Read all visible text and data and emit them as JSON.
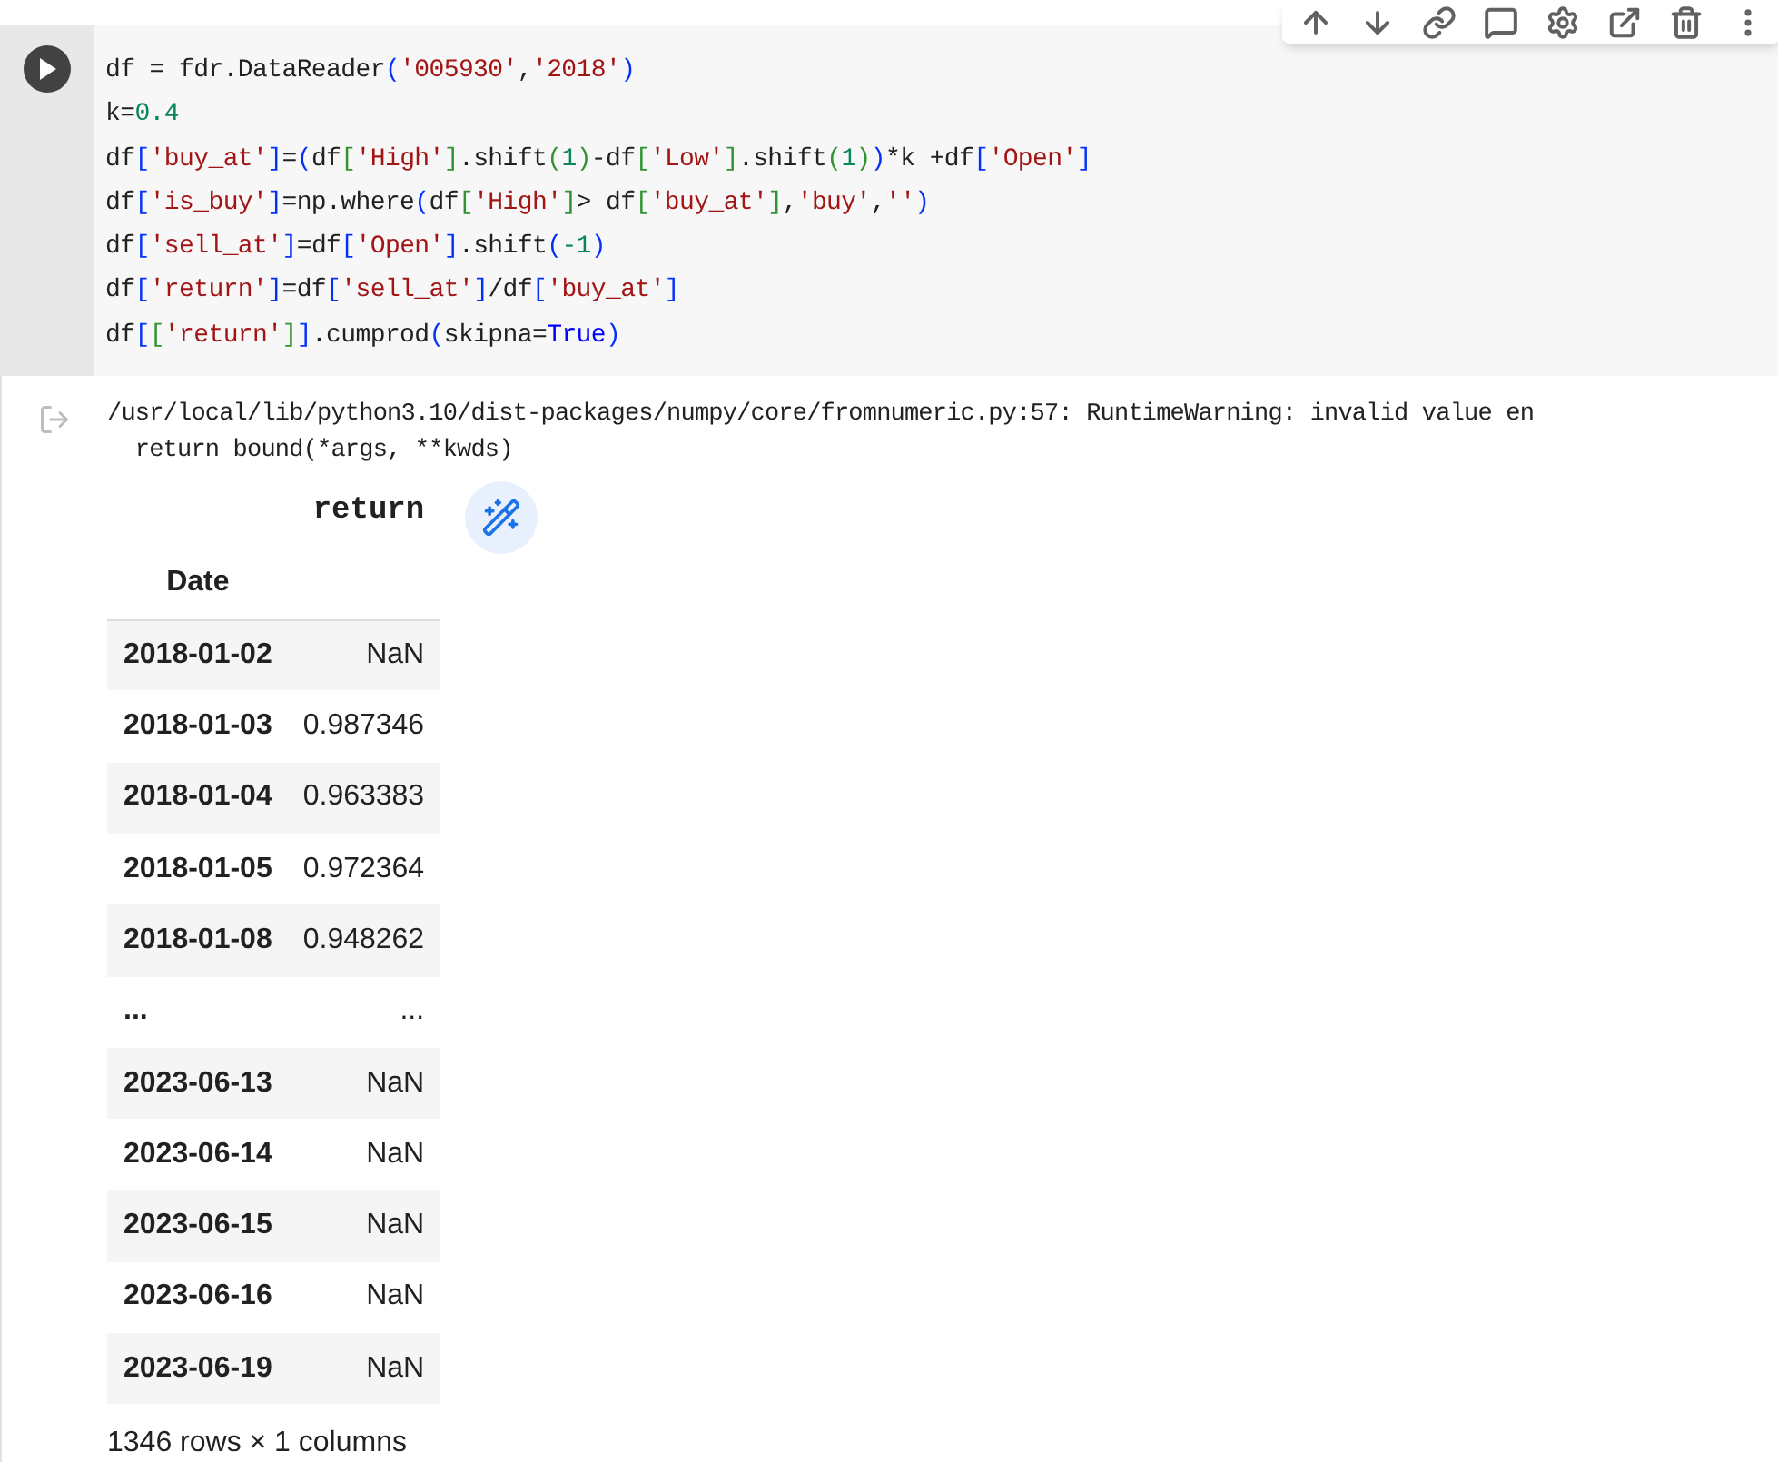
{
  "code_cell": {
    "lines": [
      [
        {
          "text": "df = fdr.DataReader",
          "kind": "plain"
        },
        {
          "text": "(",
          "kind": "b1"
        },
        {
          "text": "'005930'",
          "kind": "str"
        },
        {
          "text": ",",
          "kind": "plain"
        },
        {
          "text": "'2018'",
          "kind": "str"
        },
        {
          "text": ")",
          "kind": "b1"
        }
      ],
      [
        {
          "text": "k=",
          "kind": "plain"
        },
        {
          "text": "0.4",
          "kind": "num"
        }
      ],
      [
        {
          "text": "df",
          "kind": "plain"
        },
        {
          "text": "[",
          "kind": "b1"
        },
        {
          "text": "'buy_at'",
          "kind": "str"
        },
        {
          "text": "]",
          "kind": "b1"
        },
        {
          "text": "=",
          "kind": "plain"
        },
        {
          "text": "(",
          "kind": "b1"
        },
        {
          "text": "df",
          "kind": "plain"
        },
        {
          "text": "[",
          "kind": "b2"
        },
        {
          "text": "'High'",
          "kind": "str"
        },
        {
          "text": "]",
          "kind": "b2"
        },
        {
          "text": ".shift",
          "kind": "plain"
        },
        {
          "text": "(",
          "kind": "b2"
        },
        {
          "text": "1",
          "kind": "num"
        },
        {
          "text": ")",
          "kind": "b2"
        },
        {
          "text": "-df",
          "kind": "plain"
        },
        {
          "text": "[",
          "kind": "b2"
        },
        {
          "text": "'Low'",
          "kind": "str"
        },
        {
          "text": "]",
          "kind": "b2"
        },
        {
          "text": ".shift",
          "kind": "plain"
        },
        {
          "text": "(",
          "kind": "b2"
        },
        {
          "text": "1",
          "kind": "num"
        },
        {
          "text": ")",
          "kind": "b2"
        },
        {
          "text": ")",
          "kind": "b1"
        },
        {
          "text": "*k +df",
          "kind": "plain"
        },
        {
          "text": "[",
          "kind": "b1"
        },
        {
          "text": "'Open'",
          "kind": "str"
        },
        {
          "text": "]",
          "kind": "b1"
        }
      ],
      [
        {
          "text": "df",
          "kind": "plain"
        },
        {
          "text": "[",
          "kind": "b1"
        },
        {
          "text": "'is_buy'",
          "kind": "str"
        },
        {
          "text": "]",
          "kind": "b1"
        },
        {
          "text": "=np.where",
          "kind": "plain"
        },
        {
          "text": "(",
          "kind": "b1"
        },
        {
          "text": "df",
          "kind": "plain"
        },
        {
          "text": "[",
          "kind": "b2"
        },
        {
          "text": "'High'",
          "kind": "str"
        },
        {
          "text": "]",
          "kind": "b2"
        },
        {
          "text": "> df",
          "kind": "plain"
        },
        {
          "text": "[",
          "kind": "b2"
        },
        {
          "text": "'buy_at'",
          "kind": "str"
        },
        {
          "text": "]",
          "kind": "b2"
        },
        {
          "text": ",",
          "kind": "plain"
        },
        {
          "text": "'buy'",
          "kind": "str"
        },
        {
          "text": ",",
          "kind": "plain"
        },
        {
          "text": "''",
          "kind": "str"
        },
        {
          "text": ")",
          "kind": "b1"
        }
      ],
      [
        {
          "text": "df",
          "kind": "plain"
        },
        {
          "text": "[",
          "kind": "b1"
        },
        {
          "text": "'sell_at'",
          "kind": "str"
        },
        {
          "text": "]",
          "kind": "b1"
        },
        {
          "text": "=df",
          "kind": "plain"
        },
        {
          "text": "[",
          "kind": "b1"
        },
        {
          "text": "'Open'",
          "kind": "str"
        },
        {
          "text": "]",
          "kind": "b1"
        },
        {
          "text": ".shift",
          "kind": "plain"
        },
        {
          "text": "(",
          "kind": "b1"
        },
        {
          "text": "-1",
          "kind": "num"
        },
        {
          "text": ")",
          "kind": "b1"
        }
      ],
      [
        {
          "text": "df",
          "kind": "plain"
        },
        {
          "text": "[",
          "kind": "b1"
        },
        {
          "text": "'return'",
          "kind": "str"
        },
        {
          "text": "]",
          "kind": "b1"
        },
        {
          "text": "=df",
          "kind": "plain"
        },
        {
          "text": "[",
          "kind": "b1"
        },
        {
          "text": "'sell_at'",
          "kind": "str"
        },
        {
          "text": "]",
          "kind": "b1"
        },
        {
          "text": "/df",
          "kind": "plain"
        },
        {
          "text": "[",
          "kind": "b1"
        },
        {
          "text": "'buy_at'",
          "kind": "str"
        },
        {
          "text": "]",
          "kind": "b1"
        }
      ],
      [
        {
          "text": "df",
          "kind": "plain"
        },
        {
          "text": "[",
          "kind": "b1"
        },
        {
          "text": "[",
          "kind": "b2"
        },
        {
          "text": "'return'",
          "kind": "str"
        },
        {
          "text": "]",
          "kind": "b2"
        },
        {
          "text": "]",
          "kind": "b1"
        },
        {
          "text": ".cumprod",
          "kind": "plain"
        },
        {
          "text": "(",
          "kind": "b1"
        },
        {
          "text": "skipna=",
          "kind": "plain"
        },
        {
          "text": "True",
          "kind": "kw"
        },
        {
          "text": ")",
          "kind": "b1"
        }
      ]
    ]
  },
  "output": {
    "warning": [
      "/usr/local/lib/python3.10/dist-packages/numpy/core/fromnumeric.py:57: RuntimeWarning: invalid value en",
      "  return bound(*args, **kwds)"
    ],
    "table": {
      "column": "return",
      "index_name": "Date",
      "rows": [
        {
          "index": "2018-01-02",
          "value": "NaN"
        },
        {
          "index": "2018-01-03",
          "value": "0.987346"
        },
        {
          "index": "2018-01-04",
          "value": "0.963383"
        },
        {
          "index": "2018-01-05",
          "value": "0.972364"
        },
        {
          "index": "2018-01-08",
          "value": "0.948262"
        },
        {
          "index": "...",
          "value": "..."
        },
        {
          "index": "2023-06-13",
          "value": "NaN"
        },
        {
          "index": "2023-06-14",
          "value": "NaN"
        },
        {
          "index": "2023-06-15",
          "value": "NaN"
        },
        {
          "index": "2023-06-16",
          "value": "NaN"
        },
        {
          "index": "2023-06-19",
          "value": "NaN"
        }
      ]
    },
    "summary": "1346 rows × 1 columns"
  }
}
